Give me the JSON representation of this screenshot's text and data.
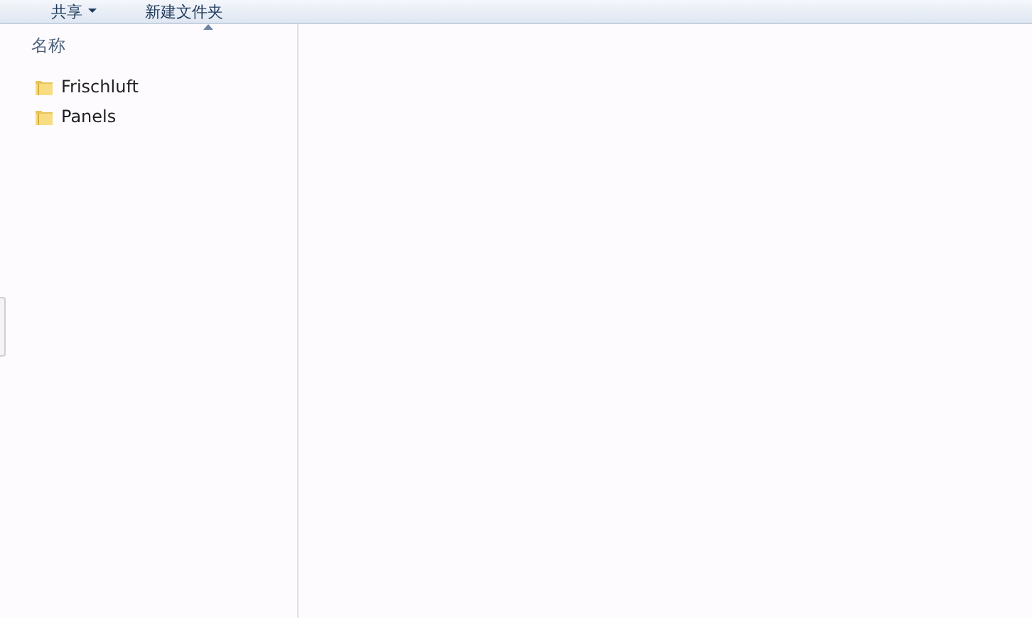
{
  "toolbar": {
    "items": [
      {
        "label": "共享",
        "has_menu": true
      },
      {
        "label": "新建文件夹",
        "has_menu": false
      }
    ]
  },
  "file_list": {
    "columns": [
      {
        "label": "名称",
        "sorted": true
      }
    ],
    "items": [
      {
        "name": "Frischluft",
        "kind": "folder"
      },
      {
        "name": "Panels",
        "kind": "folder"
      }
    ]
  }
}
